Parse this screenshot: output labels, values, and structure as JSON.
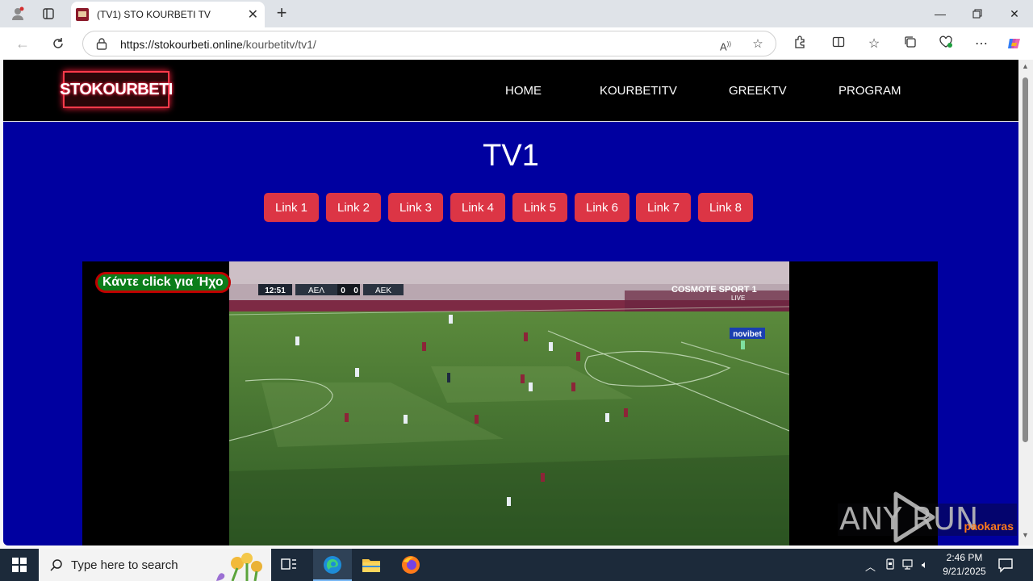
{
  "browser": {
    "tab_title": "(TV1) STO KOURBETI TV",
    "url_domain": "https://stokourbeti.online",
    "url_path": "/kourbetitv/tv1/"
  },
  "site": {
    "logo_text": "STOKOURBETI",
    "menu": [
      "HOME",
      "KOURBETITV",
      "GREEKTV",
      "PROGRAM"
    ],
    "page_title": "TV1",
    "links": [
      "Link 1",
      "Link 2",
      "Link 3",
      "Link 4",
      "Link 5",
      "Link 6",
      "Link 7",
      "Link 8"
    ]
  },
  "player": {
    "sound_button": "Κάντε click για Ήχο",
    "watermark": "paokaras",
    "scoreboard": {
      "time": "12:51",
      "home": "ΑΕΛ",
      "home_score": "0",
      "away_score": "0",
      "away": "ΑΕΚ"
    },
    "broadcaster": "COSMOTE SPORT 1",
    "broadcaster_sub": "LIVE",
    "ad_board": "novibet"
  },
  "overlay": {
    "anyrun_text": "ANY RUN"
  },
  "taskbar": {
    "search_placeholder": "Type here to search",
    "time": "2:46 PM",
    "date": "9/21/2025"
  },
  "colors": {
    "page_bg": "#0000a0",
    "link_button": "#dc3545",
    "header_bg": "#000000"
  }
}
